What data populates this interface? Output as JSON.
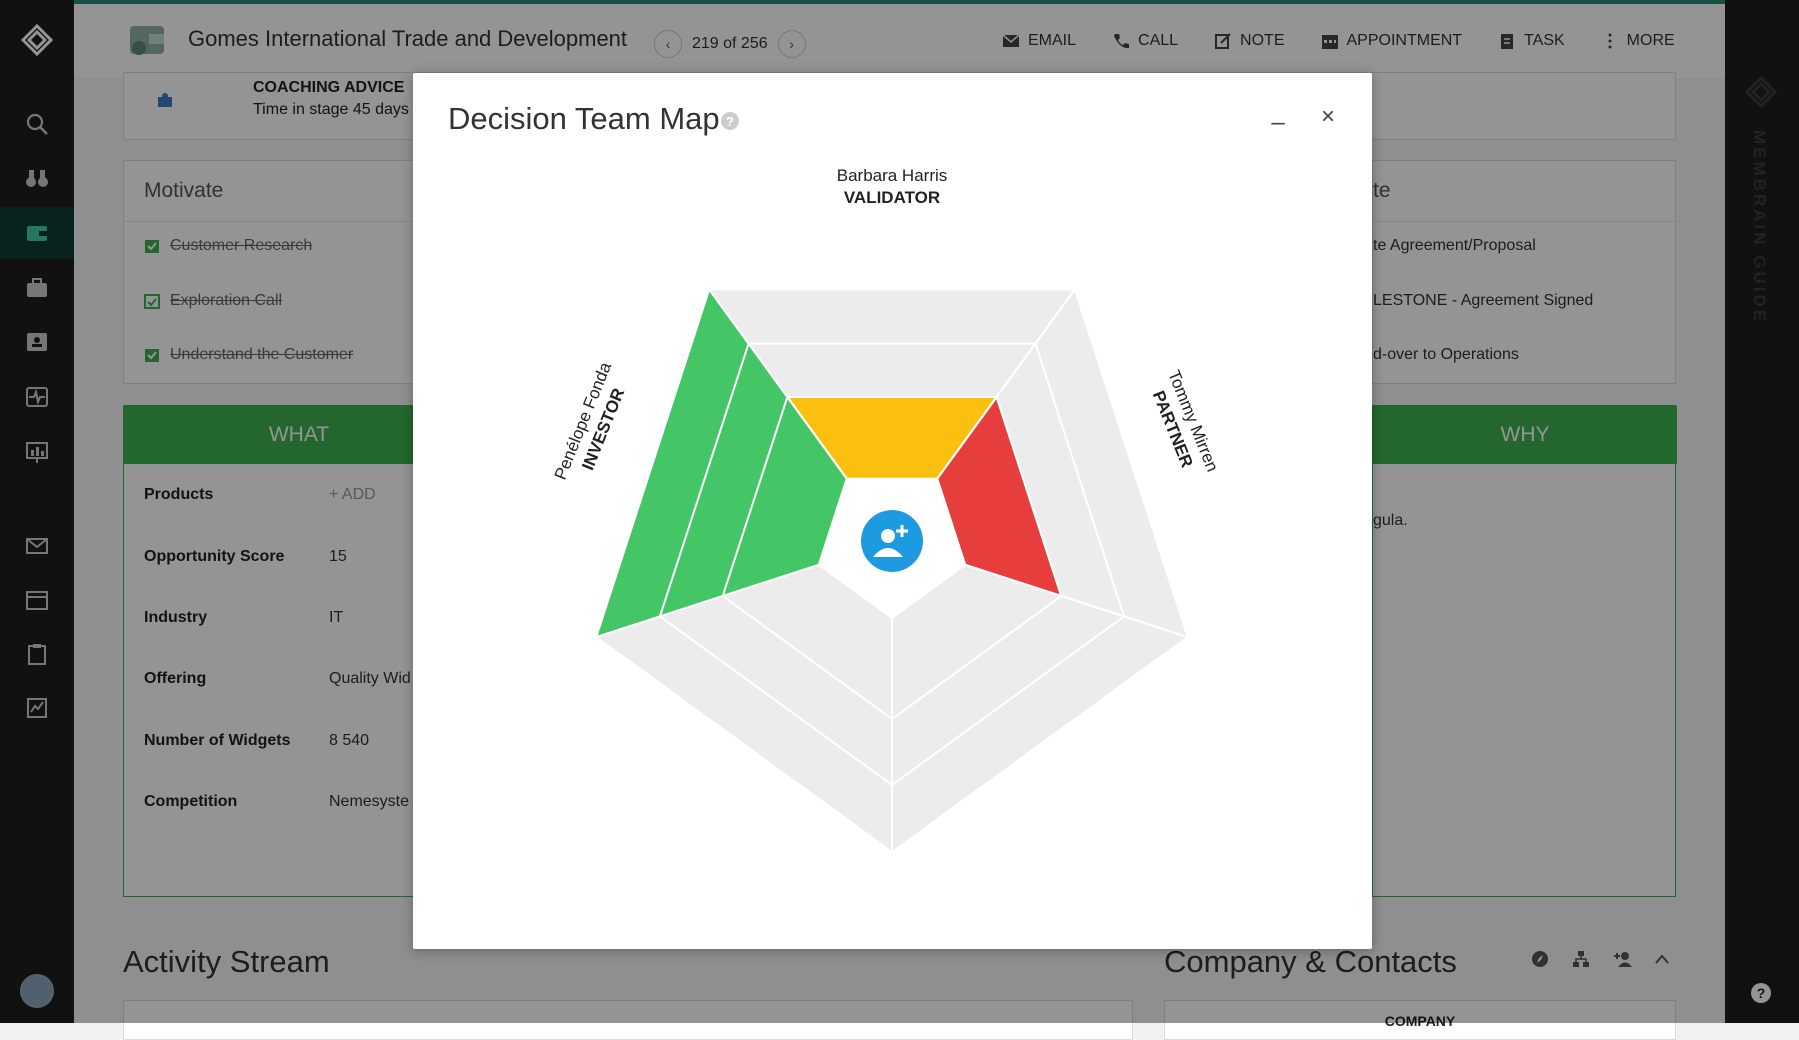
{
  "topbar": {
    "title": "Gomes International Trade and Development",
    "pager": "219 of 256",
    "actions": [
      {
        "icon": "email-icon",
        "label": "EMAIL"
      },
      {
        "icon": "phone-icon",
        "label": "CALL"
      },
      {
        "icon": "note-icon",
        "label": "NOTE"
      },
      {
        "icon": "calendar-icon",
        "label": "APPOINTMENT"
      },
      {
        "icon": "task-icon",
        "label": "TASK"
      },
      {
        "icon": "more-icon",
        "label": "MORE"
      }
    ]
  },
  "coaching": {
    "title": "COACHING ADVICE",
    "subtitle": "Time in stage 45 days"
  },
  "motivate": {
    "title": "Motivate",
    "items": [
      "Customer Research",
      "Exploration Call",
      "Understand the Customer"
    ]
  },
  "right_card": {
    "title_fragment": "te",
    "items": [
      "te Agreement/Proposal",
      "LESTONE - Agreement Signed",
      "d-over to Operations"
    ]
  },
  "what_panel": {
    "header": "WHAT",
    "rows": [
      {
        "label": "Products",
        "value": "+ ADD"
      },
      {
        "label": "Opportunity Score",
        "value": "15"
      },
      {
        "label": "Industry",
        "value": "IT"
      },
      {
        "label": "Offering",
        "value": "Quality Wid"
      },
      {
        "label": "Number of Widgets",
        "value": "8 540"
      },
      {
        "label": "Competition",
        "value": "Nemesyste"
      }
    ]
  },
  "why_panel": {
    "header": "WHY",
    "text": "gula."
  },
  "sections": {
    "activity": "Activity Stream",
    "company": "Company & Contacts",
    "company_col": "COMPANY"
  },
  "rail_text": "MEMBRAIN GUIDE",
  "modal": {
    "title": "Decision Team Map",
    "minimize": "–",
    "close": "×",
    "roles": [
      {
        "position": "top",
        "name": "Barbara Harris",
        "role": "VALIDATOR",
        "color": "#fbbf10"
      },
      {
        "position": "left",
        "name": "Penélope Fonda",
        "role": "INVESTOR",
        "color": "#45c666"
      },
      {
        "position": "right",
        "name": "Tommy Mirren",
        "role": "PARTNER",
        "color": "#e63d3d"
      }
    ],
    "add_button_icon": "add-user-icon",
    "colors": {
      "empty": "#ececec",
      "add_button": "#1e9be0"
    }
  }
}
